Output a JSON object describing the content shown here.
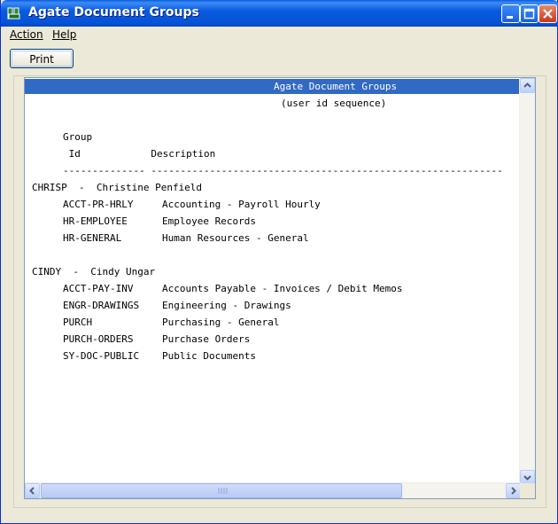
{
  "window": {
    "title": "Agate Document Groups"
  },
  "menu": {
    "items": [
      {
        "label": "Action"
      },
      {
        "label": "Help"
      }
    ]
  },
  "toolbar": {
    "print_label": "Print"
  },
  "report": {
    "title": "Agate Document Groups",
    "subtitle": "(user id sequence)",
    "col_header_1": "Group",
    "col_header_2": " Id            Description",
    "separator": "-------------- ------------------------------------------------------------",
    "users": [
      {
        "header": "CHRISP  -  Christine Penfield",
        "groups": [
          {
            "id": "ACCT-PR-HRLY",
            "desc": "Accounting - Payroll Hourly"
          },
          {
            "id": "HR-EMPLOYEE",
            "desc": "Employee Records"
          },
          {
            "id": "HR-GENERAL",
            "desc": "Human Resources - General"
          }
        ]
      },
      {
        "header": "CINDY  -  Cindy Ungar",
        "groups": [
          {
            "id": "ACCT-PAY-INV",
            "desc": "Accounts Payable - Invoices / Debit Memos"
          },
          {
            "id": "ENGR-DRAWINGS",
            "desc": "Engineering - Drawings"
          },
          {
            "id": "PURCH",
            "desc": "Purchasing - General"
          },
          {
            "id": "PURCH-ORDERS",
            "desc": "Purchase Orders"
          },
          {
            "id": "SY-DOC-PUBLIC",
            "desc": "Public Documents"
          }
        ]
      }
    ]
  },
  "colors": {
    "titlebar": "#0a5be0",
    "selection": "#316ac5",
    "face": "#ece9d8"
  },
  "icons": [
    "app-icon",
    "minimize-icon",
    "maximize-icon",
    "close-icon",
    "scroll-up-arrow-icon",
    "scroll-down-arrow-icon",
    "scroll-left-arrow-icon",
    "scroll-right-arrow-icon"
  ]
}
